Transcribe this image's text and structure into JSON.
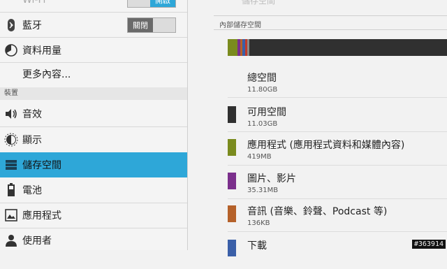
{
  "left": {
    "wifi": {
      "label": "Wi-Fi",
      "toggle": "開啟"
    },
    "bluetooth": {
      "label": "藍牙",
      "toggle": "關閉"
    },
    "data_usage": {
      "label": "資料用量"
    },
    "more": {
      "label": "更多內容..."
    },
    "section_device": "裝置",
    "items": [
      {
        "label": "音效",
        "icon": "volume-icon"
      },
      {
        "label": "顯示",
        "icon": "brightness-icon"
      },
      {
        "label": "儲存空間",
        "icon": "storage-icon",
        "active": true
      },
      {
        "label": "電池",
        "icon": "battery-icon"
      },
      {
        "label": "應用程式",
        "icon": "apps-icon"
      },
      {
        "label": "使用者",
        "icon": "user-icon"
      }
    ]
  },
  "right": {
    "faded_header": "儲存空間",
    "section_title": "內部儲存空間",
    "bar_colors": {
      "apps": "#7a8b1e",
      "pictures": "#7b2f8c",
      "audio": "#b5612a",
      "downloads": "#3a5fa8",
      "misc": "#c23a2a",
      "free": "#303030"
    },
    "items": [
      {
        "name": "總空間",
        "size": "11.80GB"
      },
      {
        "name": "可用空間",
        "size": "11.03GB",
        "color": "#303030"
      },
      {
        "name": "應用程式 (應用程式資料和媒體內容)",
        "size": "419MB",
        "color": "#7a8b1e"
      },
      {
        "name": "圖片、影片",
        "size": "35.31MB",
        "color": "#7b2f8c"
      },
      {
        "name": "音訊 (音樂、鈴聲、Podcast 等)",
        "size": "136KB",
        "color": "#b5612a"
      },
      {
        "name": "下載",
        "size": "",
        "color": "#3a5fa8"
      }
    ]
  },
  "watermark": "#363914"
}
